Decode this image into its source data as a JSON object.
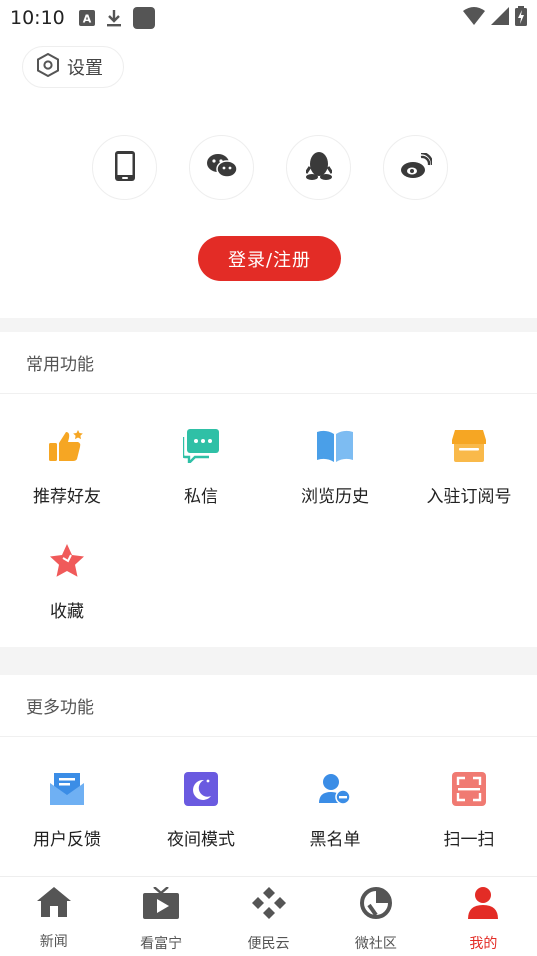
{
  "status": {
    "time": "10:10"
  },
  "settings": {
    "label": "设置"
  },
  "login": {
    "options": [
      "phone-icon",
      "wechat-icon",
      "qq-icon",
      "weibo-icon"
    ],
    "button_label": "登录/注册",
    "button_color": "#e32c26"
  },
  "common": {
    "title": "常用功能",
    "items": [
      {
        "label": "推荐好友",
        "icon": "thumbs-up-icon"
      },
      {
        "label": "私信",
        "icon": "message-icon"
      },
      {
        "label": "浏览历史",
        "icon": "book-icon"
      },
      {
        "label": "入驻订阅号",
        "icon": "store-icon"
      },
      {
        "label": "收藏",
        "icon": "star-icon"
      }
    ]
  },
  "more": {
    "title": "更多功能",
    "items": [
      {
        "label": "用户反馈",
        "icon": "feedback-mail-icon"
      },
      {
        "label": "夜间模式",
        "icon": "moon-icon"
      },
      {
        "label": "黑名单",
        "icon": "user-minus-icon"
      },
      {
        "label": "扫一扫",
        "icon": "scan-icon"
      }
    ]
  },
  "tabs": [
    {
      "label": "新闻",
      "icon": "home-icon",
      "active": false
    },
    {
      "label": "看富宁",
      "icon": "tv-play-icon",
      "active": false
    },
    {
      "label": "便民云",
      "icon": "diamond-grid-icon",
      "active": false
    },
    {
      "label": "微社区",
      "icon": "community-icon",
      "active": false
    },
    {
      "label": "我的",
      "icon": "person-icon",
      "active": true
    }
  ],
  "accent_color": "#e32c26"
}
